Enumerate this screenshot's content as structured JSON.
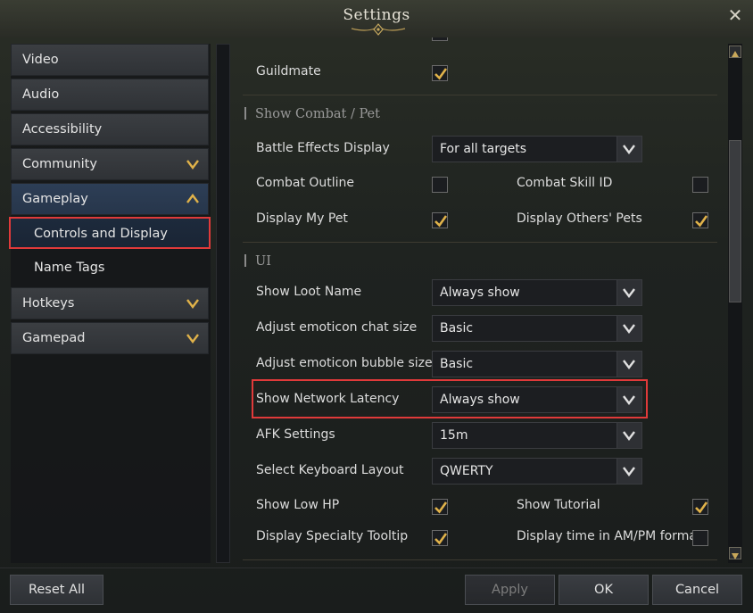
{
  "window": {
    "title": "Settings"
  },
  "sidebar": {
    "items": [
      {
        "label": "Video"
      },
      {
        "label": "Audio"
      },
      {
        "label": "Accessibility"
      },
      {
        "label": "Community"
      },
      {
        "label": "Gameplay"
      },
      {
        "label": "Controls and Display"
      },
      {
        "label": "Name Tags"
      },
      {
        "label": "Hotkeys"
      },
      {
        "label": "Gamepad"
      }
    ]
  },
  "content": {
    "guildmate": {
      "label": "Guildmate",
      "checked": true
    },
    "combat_section": {
      "title": "Show Combat / Pet"
    },
    "battle_effects": {
      "label": "Battle Effects Display",
      "value": "For all targets"
    },
    "combat_outline": {
      "label": "Combat Outline",
      "checked": false
    },
    "combat_skill_id": {
      "label": "Combat Skill ID",
      "checked": false
    },
    "display_my_pet": {
      "label": "Display My Pet",
      "checked": true
    },
    "display_others_pets": {
      "label": "Display Others' Pets",
      "checked": true
    },
    "ui_section": {
      "title": "UI"
    },
    "show_loot_name": {
      "label": "Show Loot Name",
      "value": "Always show"
    },
    "emoticon_chat": {
      "label": "Adjust emoticon chat size",
      "value": "Basic"
    },
    "emoticon_bubble": {
      "label": "Adjust emoticon bubble size",
      "value": "Basic"
    },
    "network_latency": {
      "label": "Show Network Latency",
      "value": "Always show"
    },
    "afk": {
      "label": "AFK Settings",
      "value": "15m"
    },
    "keyboard_layout": {
      "label": "Select Keyboard Layout",
      "value": "QWERTY"
    },
    "low_hp": {
      "label": "Show Low HP",
      "checked": true
    },
    "tutorial": {
      "label": "Show Tutorial",
      "checked": true
    },
    "specialty_tooltip": {
      "label": "Display Specialty Tooltip",
      "checked": true
    },
    "ampm": {
      "label": "Display time in AM/PM format",
      "checked": false
    }
  },
  "footer": {
    "reset": "Reset All",
    "apply": "Apply",
    "ok": "OK",
    "cancel": "Cancel"
  },
  "colors": {
    "accent_gold": "#e0b24a",
    "highlight_red": "#e03a3a",
    "selected_bg": "#1d2a3c"
  }
}
